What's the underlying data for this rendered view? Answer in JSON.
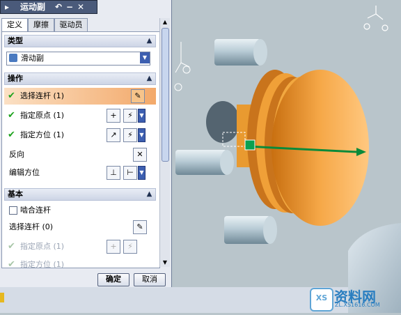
{
  "colors": {
    "accent_selection": "#f3a96a",
    "check_green": "#1da31d",
    "part_orange": "#f0a030",
    "background_gray": "#b9c5cb"
  },
  "dialog": {
    "title": "运动副",
    "title_buttons": [
      "↶",
      "−",
      "✕",
      "▸"
    ],
    "tabs": [
      {
        "label": "定义",
        "active": true
      },
      {
        "label": "摩擦",
        "active": false
      },
      {
        "label": "驱动员",
        "active": false
      }
    ],
    "type_section": {
      "header": "类型",
      "selected": "滑动副"
    },
    "operation_section": {
      "header": "操作",
      "rows": [
        {
          "label": "选择连杆 (1)",
          "checked": true,
          "highlighted": true
        },
        {
          "label": "指定原点 (1)",
          "checked": true
        },
        {
          "label": "指定方位 (1)",
          "checked": true
        },
        {
          "label": "反向",
          "checked": false
        },
        {
          "label": "编辑方位",
          "checked": false
        }
      ]
    },
    "basic_section": {
      "header": "基本",
      "snap_link_label": "啮合连杆",
      "rows": [
        {
          "label": "选择连杆 (0)"
        },
        {
          "label": "指定原点 (1)"
        },
        {
          "label": "指定方位 (1)"
        }
      ]
    },
    "ok_label": "确定",
    "cancel_label": "取消"
  },
  "watermark": {
    "site_name": "资料网",
    "site_url": "ZL.XS1616.COM"
  }
}
